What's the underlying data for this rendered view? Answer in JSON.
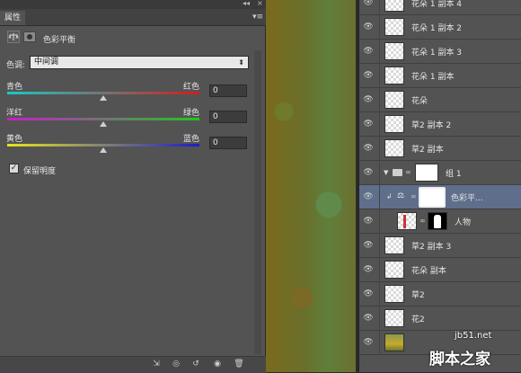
{
  "properties_panel": {
    "tab_label": "属性",
    "collapse_label": "◂◂",
    "close_label": "×",
    "menu_label": "▾≡",
    "adjustment_title": "色彩平衡",
    "tone_label": "色调:",
    "tone_value": "中间调",
    "sliders": [
      {
        "left": "青色",
        "right": "红色",
        "value": "0",
        "level": 0,
        "gradient": [
          "#19c8c8",
          "#d21e1e"
        ]
      },
      {
        "left": "洋红",
        "right": "绿色",
        "value": "0",
        "level": 0,
        "gradient": [
          "#c81ec8",
          "#1ec81e"
        ]
      },
      {
        "left": "黄色",
        "right": "蓝色",
        "value": "0",
        "level": 0,
        "gradient": [
          "#e6e61e",
          "#1e1ec8"
        ]
      }
    ],
    "preserve_luminosity_label": "保留明度",
    "preserve_luminosity_checked": true
  },
  "layers_panel": {
    "layers": [
      {
        "name": "花朵 1 副本 4",
        "thumb": "transparent",
        "selected": false
      },
      {
        "name": "花朵 1 副本 2",
        "thumb": "transparent",
        "selected": false
      },
      {
        "name": "花朵 1 副本 3",
        "thumb": "transparent",
        "selected": false
      },
      {
        "name": "花朵 1 副本",
        "thumb": "transparent",
        "selected": false
      },
      {
        "name": "花朵",
        "thumb": "transparent",
        "selected": false
      },
      {
        "name": "草2 副本 2",
        "thumb": "transparent",
        "selected": false
      },
      {
        "name": "草2 副本",
        "thumb": "transparent",
        "selected": false
      },
      {
        "name": "组 1",
        "thumb": "group",
        "selected": false
      },
      {
        "name": "色彩平...",
        "thumb": "adjustment",
        "selected": true
      },
      {
        "name": "人物",
        "thumb": "person",
        "selected": false
      },
      {
        "name": "草2 副本 3",
        "thumb": "transparent",
        "selected": false
      },
      {
        "name": "花朵 副本",
        "thumb": "transparent",
        "selected": false
      },
      {
        "name": "草2",
        "thumb": "transparent",
        "selected": false
      },
      {
        "name": "花2",
        "thumb": "transparent",
        "selected": false
      },
      {
        "name": "",
        "thumb": "photo",
        "selected": false
      }
    ]
  },
  "watermark": {
    "url": "jb51.net",
    "site_name": "脚本之家"
  },
  "colors": {
    "panel_bg": "#535353",
    "selected_row": "#5f6e8a",
    "canvas_olive": "#7a6a1e"
  }
}
